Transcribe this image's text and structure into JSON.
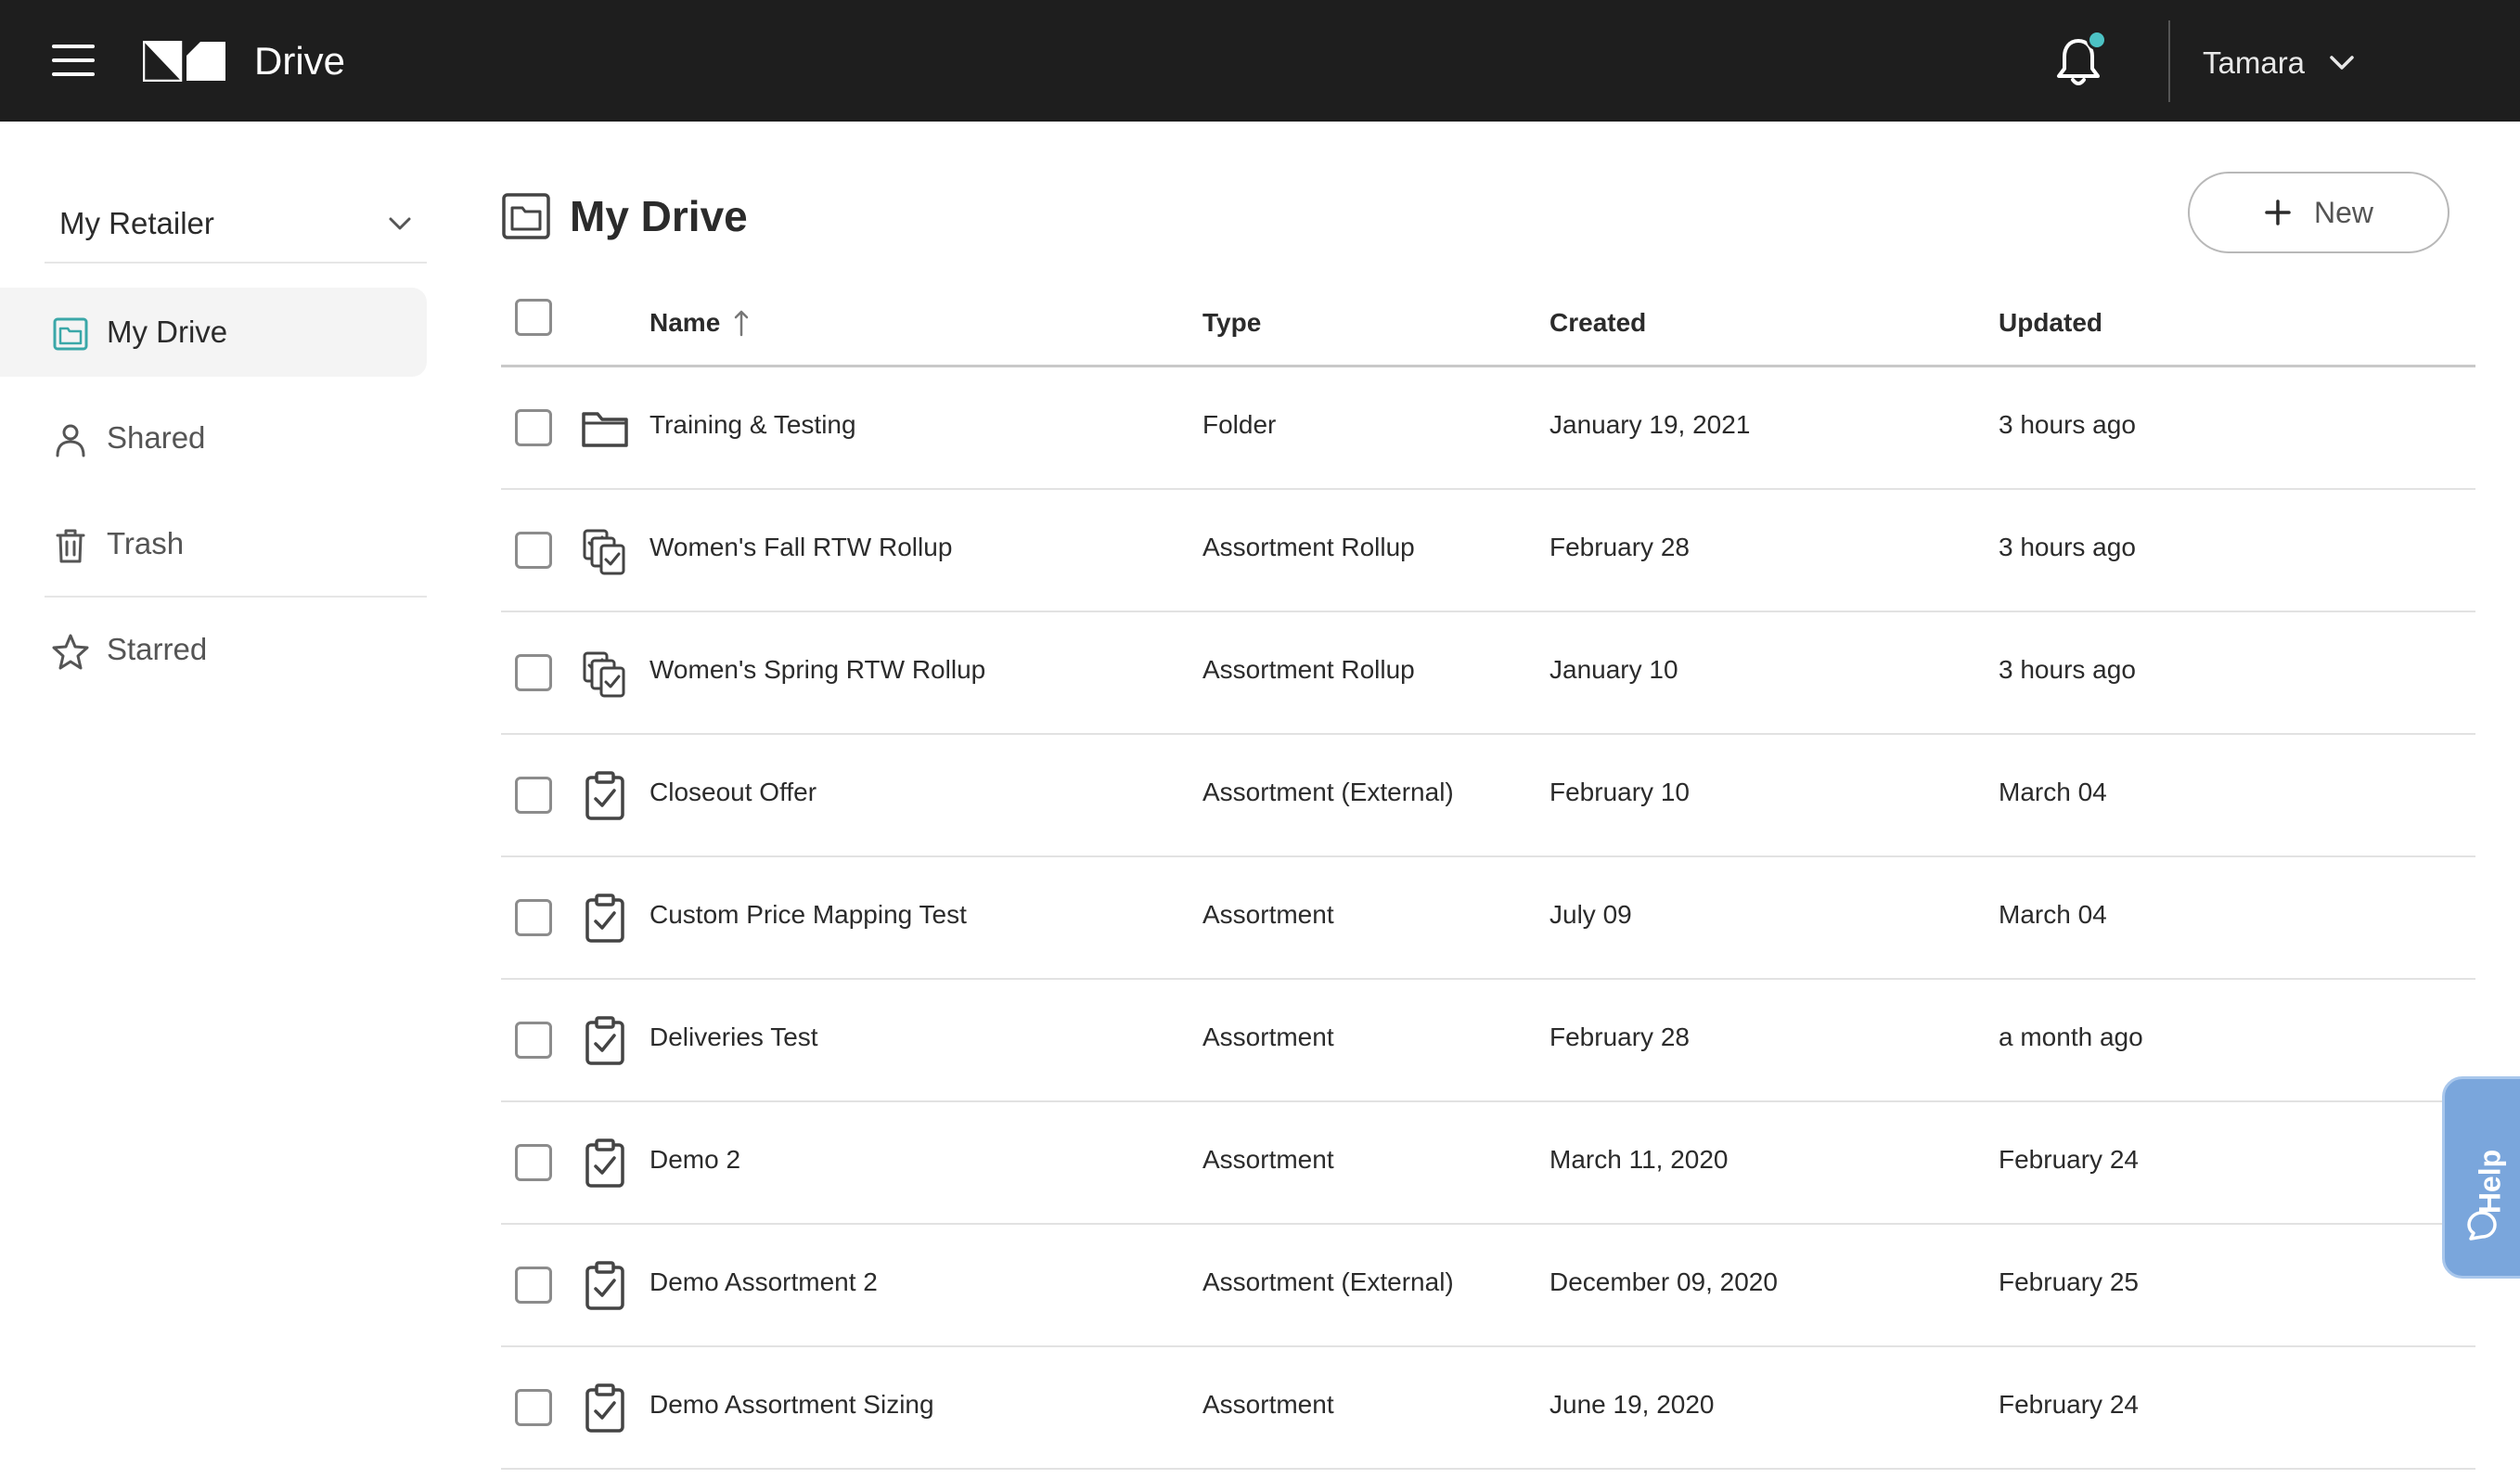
{
  "app": {
    "title": "Drive",
    "user_name": "Tamara"
  },
  "sidebar": {
    "retailer_label": "My Retailer",
    "items": [
      {
        "label": "My Drive",
        "icon": "folder-teal-icon",
        "active": true
      },
      {
        "label": "Shared",
        "icon": "person-icon"
      },
      {
        "label": "Trash",
        "icon": "trash-icon"
      },
      {
        "label": "Starred",
        "icon": "star-icon"
      }
    ]
  },
  "main": {
    "title": "My Drive",
    "new_label": "New",
    "columns": {
      "name": "Name",
      "type": "Type",
      "created": "Created",
      "updated": "Updated"
    },
    "rows": [
      {
        "name": "Training & Testing",
        "type": "Folder",
        "created": "January 19, 2021",
        "updated": "3 hours ago",
        "icon": "folder-icon"
      },
      {
        "name": "Women's Fall RTW Rollup",
        "type": "Assortment Rollup",
        "created": "February 28",
        "updated": "3 hours ago",
        "icon": "rollup-icon"
      },
      {
        "name": "Women's Spring RTW Rollup",
        "type": "Assortment Rollup",
        "created": "January 10",
        "updated": "3 hours ago",
        "icon": "rollup-icon"
      },
      {
        "name": "Closeout Offer",
        "type": "Assortment (External)",
        "created": "February 10",
        "updated": "March 04",
        "icon": "clipboard-check-icon"
      },
      {
        "name": "Custom Price Mapping Test",
        "type": "Assortment",
        "created": "July 09",
        "updated": "March 04",
        "icon": "clipboard-check-icon"
      },
      {
        "name": "Deliveries Test",
        "type": "Assortment",
        "created": "February 28",
        "updated": "a month ago",
        "icon": "clipboard-check-icon"
      },
      {
        "name": "Demo 2",
        "type": "Assortment",
        "created": "March 11, 2020",
        "updated": "February 24",
        "icon": "clipboard-check-icon"
      },
      {
        "name": "Demo Assortment 2",
        "type": "Assortment (External)",
        "created": "December 09, 2020",
        "updated": "February 25",
        "icon": "clipboard-check-icon"
      },
      {
        "name": "Demo Assortment Sizing",
        "type": "Assortment",
        "created": "June 19, 2020",
        "updated": "February 24",
        "icon": "clipboard-check-icon"
      }
    ]
  },
  "help": {
    "label": "Help"
  },
  "colors": {
    "topbar": "#1e1e1e",
    "notification_dot": "#4cc2c4",
    "active_nav_icon": "#3aa7a8",
    "help_tab": "#7aa6dc"
  }
}
